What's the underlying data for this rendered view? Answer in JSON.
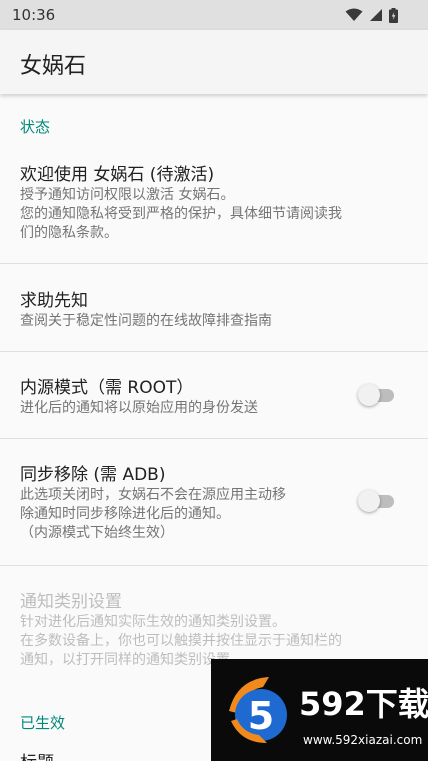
{
  "status_bar": {
    "time": "10:36",
    "icons": [
      "wifi-icon",
      "signal-icon",
      "battery-icon"
    ]
  },
  "app_bar": {
    "title": "女娲石"
  },
  "sections": {
    "status": {
      "header": "状态"
    },
    "active": {
      "header": "已生效",
      "first_item_partial": "标题"
    }
  },
  "prefs": {
    "welcome": {
      "title": "欢迎使用 女娲石 (待激活)",
      "summary_lines": [
        "授予通知访问权限以激活 女娲石。",
        "您的通知隐私将受到严格的保护，具体细节请阅读我",
        "们的隐私条款。"
      ]
    },
    "help": {
      "title": "求助先知",
      "summary": "查阅关于稳定性问题的在线故障排查指南"
    },
    "source_mode": {
      "title": "内源模式（需 ROOT）",
      "summary": "进化后的通知将以原始应用的身份发送",
      "enabled": false
    },
    "sync_remove": {
      "title": "同步移除 (需 ADB)",
      "summary_lines": [
        "此选项关闭时，女娲石不会在源应用主动移",
        "除通知时同步移除进化后的通知。",
        "（内源模式下始终生效）"
      ],
      "enabled": false
    },
    "channel_settings": {
      "title": "通知类别设置",
      "summary_lines": [
        "针对进化后通知实际生效的通知类别设置。",
        "在多数设备上，你也可以触摸并按住显示于通知栏的",
        "通知，以打开同样的通知类别设置。"
      ],
      "disabled": true
    }
  },
  "watermark": {
    "brand": "592下载",
    "url": "www.592xiazai.com",
    "logo_digit": "5"
  },
  "colors": {
    "accent": "#00897b",
    "background": "#fafafa",
    "status_bar": "#e0e0e0",
    "watermark_bg": "#0a0a0a",
    "logo_blue": "#1e6ad1",
    "logo_orange": "#f08a1c"
  }
}
